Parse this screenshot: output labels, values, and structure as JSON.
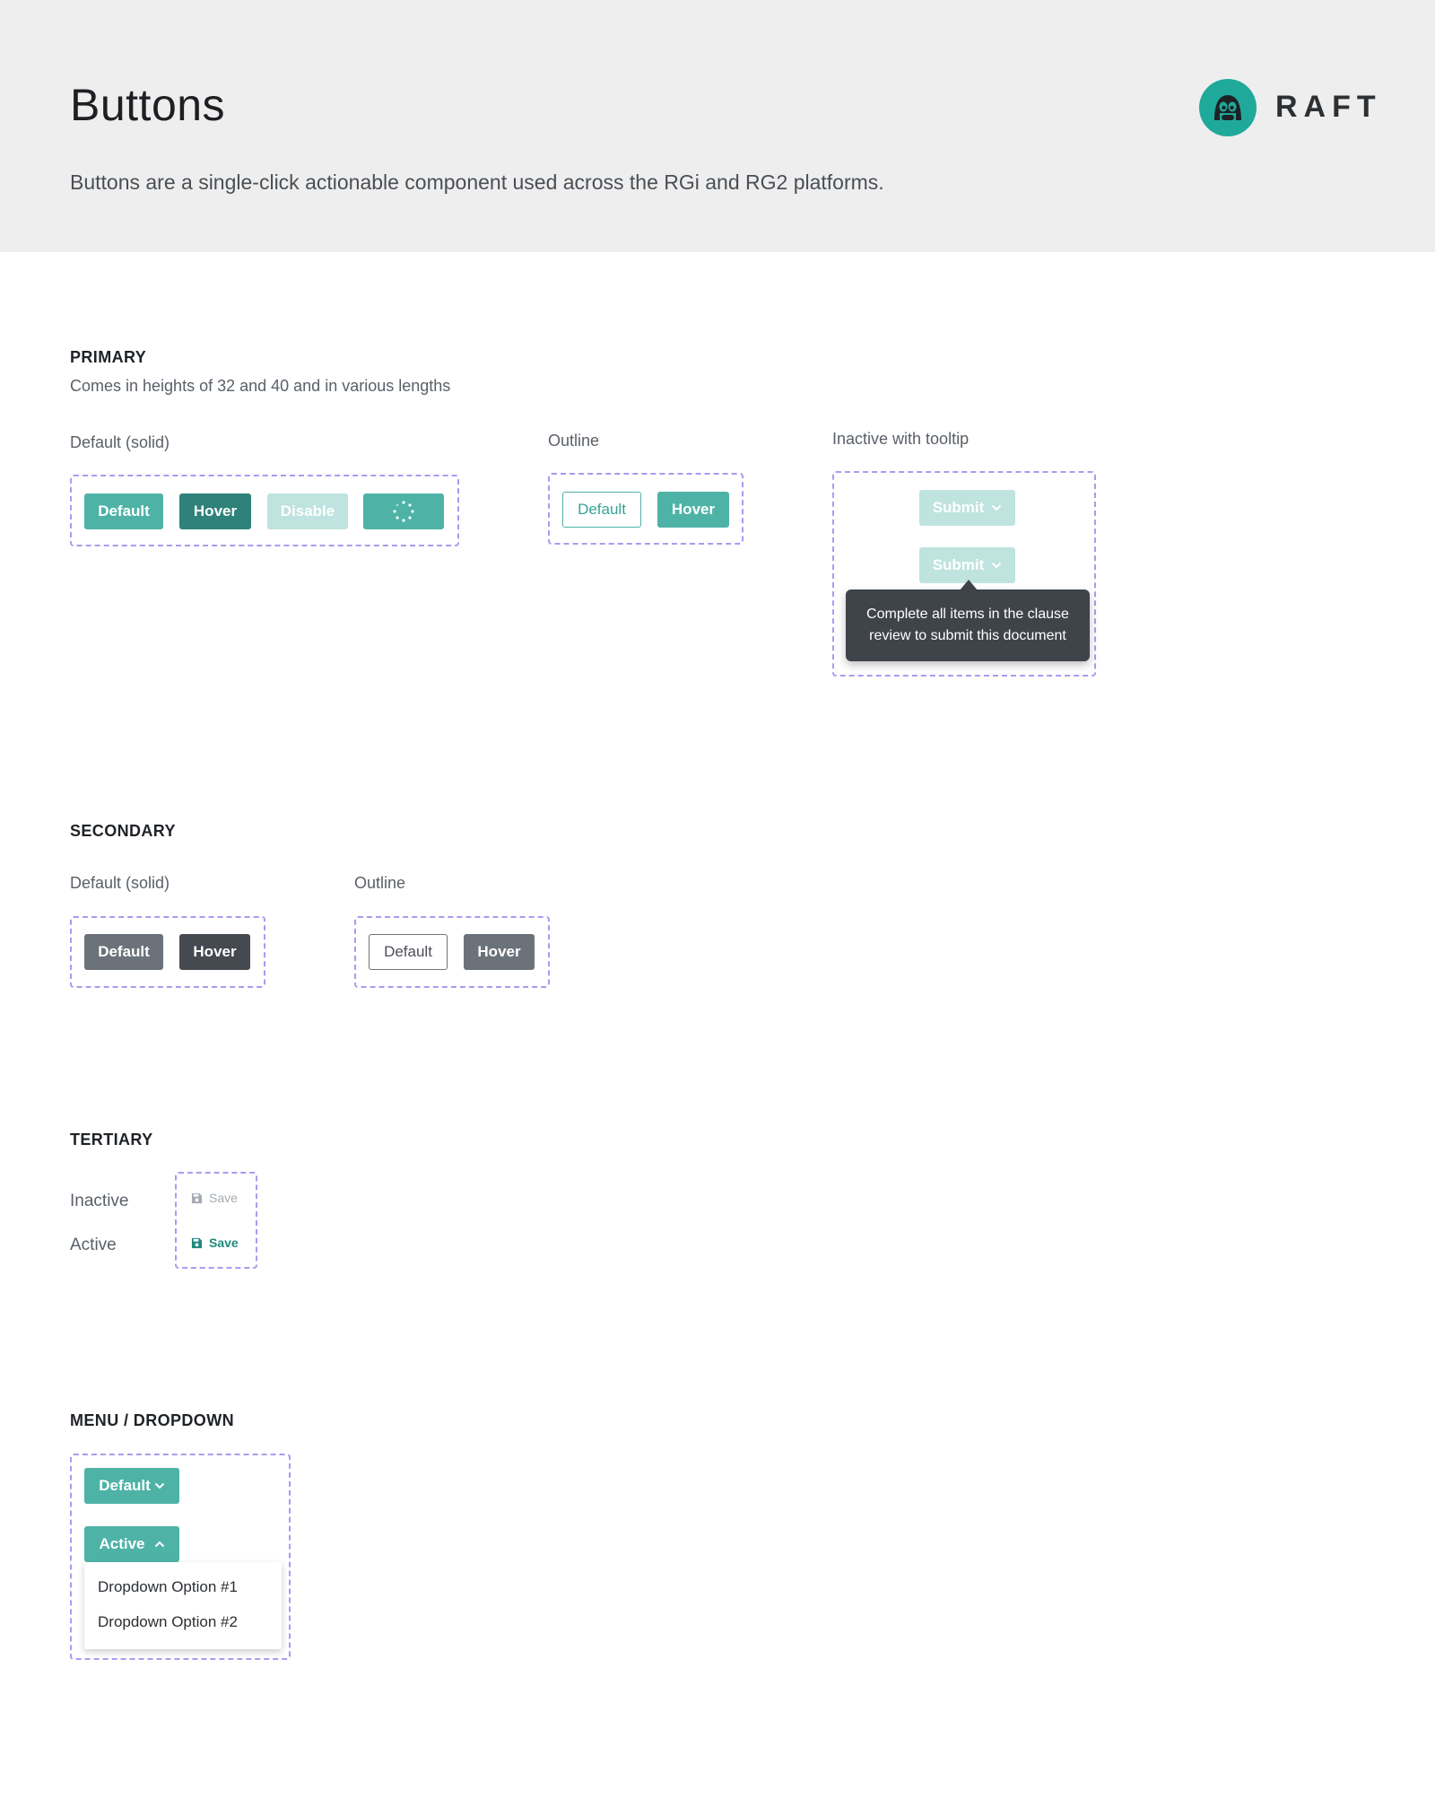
{
  "header": {
    "title": "Buttons",
    "description": "Buttons are a single-click actionable component used across the RGi and RG2 platforms.",
    "logo_text": "RAFT",
    "logo_icon": "raft-mascot-icon",
    "logo_color": "#1fa99a",
    "background_color": "#eeeeee"
  },
  "colors": {
    "primary": "#4eb3a6",
    "primary_hover": "#2f8279",
    "primary_disabled": "#bfe3de",
    "secondary": "#6b727a",
    "secondary_hover": "#454a50",
    "guide_dash": "#a79cf2",
    "tooltip_bg": "#3f444a"
  },
  "primary": {
    "title": "PRIMARY",
    "subtitle": "Comes in heights of 32 and 40 and in various lengths",
    "solid": {
      "label": "Default (solid)",
      "buttons": [
        "Default",
        "Hover",
        "Disable"
      ],
      "loading_icon": "spinner-icon"
    },
    "outline": {
      "label": "Outline",
      "buttons": [
        "Default",
        "Hover"
      ]
    },
    "inactive_tooltip": {
      "label": "Inactive with tooltip",
      "button": "Submit",
      "chevron_icon": "chevron-down-icon",
      "tooltip_line1": "Complete all items in the clause",
      "tooltip_line2": "review to submit this document"
    }
  },
  "secondary": {
    "title": "SECONDARY",
    "solid": {
      "label": "Default (solid)",
      "buttons": [
        "Default",
        "Hover"
      ]
    },
    "outline": {
      "label": "Outline",
      "buttons": [
        "Default",
        "Hover"
      ]
    }
  },
  "tertiary": {
    "title": "TERTIARY",
    "inactive_label": "Inactive",
    "active_label": "Active",
    "button": "Save",
    "icon": "floppy-disk-icon"
  },
  "menu_dropdown": {
    "title": "MENU / DROPDOWN",
    "default_button": "Default",
    "active_button": "Active",
    "chevron_down_icon": "chevron-down-icon",
    "chevron_up_icon": "chevron-up-icon",
    "options": [
      "Dropdown Option #1",
      "Dropdown Option #2"
    ]
  }
}
